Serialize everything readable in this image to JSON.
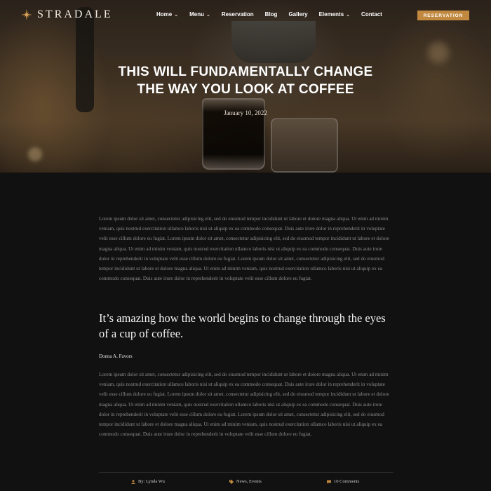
{
  "brand": {
    "name": "STRADALE"
  },
  "nav": {
    "items": [
      {
        "label": "Home",
        "has_dropdown": true
      },
      {
        "label": "Menu",
        "has_dropdown": true
      },
      {
        "label": "Reservation",
        "has_dropdown": false
      },
      {
        "label": "Blog",
        "has_dropdown": false
      },
      {
        "label": "Gallery",
        "has_dropdown": false
      },
      {
        "label": "Elements",
        "has_dropdown": true
      },
      {
        "label": "Contact",
        "has_dropdown": false
      }
    ],
    "reservation_button": "RESERVATION"
  },
  "hero": {
    "title_line1": "THIS WILL FUNDAMENTALLY CHANGE",
    "title_line2": "THE WAY YOU LOOK AT COFFEE",
    "date": "January 10, 2022"
  },
  "article": {
    "paragraph1": "Lorem ipsum dolor sit amet, consectetur adipisicing elit, sed do eiusmod tempor incididunt ut labore et dolore magna aliqua. Ut enim ad minim veniam, quis nostrud exercitation ullamco laboris nisi ut aliquip ex ea commodo consequat. Duis aute irure dolor in reprehenderit in voluptate velit esse cillum dolore eu fugiat. Lorem ipsum dolor sit amet, consectetur adipisicing elit, sed do eiusmod tempor incididunt ut labore et dolore magna aliqua. Ut enim ad minim veniam, quis nostrud exercitation ullamco laboris nisi ut aliquip ex ea commodo consequat. Duis aute irure dolor in reprehenderit in voluptate velit esse cillum dolore eu fugiat. Lorem ipsum dolor sit amet, consectetur adipisicing elit, sed do eiusmod tempor incididunt ut labore et dolore magna aliqua. Ut enim ad minim veniam, quis nostrud exercitation ullamco laboris nisi ut aliquip ex ea commodo consequat. Duis aute irure dolor in reprehenderit in voluptate velit esse cillum dolore eu fugiat.",
    "quote": "It’s amazing how the world begins to change through the eyes of a cup of coffee.",
    "quote_author": "Donna A. Favors",
    "paragraph2": "Lorem ipsum dolor sit amet, consectetur adipisicing elit, sed do eiusmod tempor incididunt ut labore et dolore magna aliqua. Ut enim ad minim veniam, quis nostrud exercitation ullamco laboris nisi ut aliquip ex ea commodo consequat. Duis aute irure dolor in reprehenderit in voluptate velit esse cillum dolore eu fugiat. Lorem ipsum dolor sit amet, consectetur adipisicing elit, sed do eiusmod tempor incididunt ut labore et dolore magna aliqua. Ut enim ad minim veniam, quis nostrud exercitation ullamco laboris nisi ut aliquip ex ea commodo consequat. Duis aute irure dolor in reprehenderit in voluptate velit esse cillum dolore eu fugiat. Lorem ipsum dolor sit amet, consectetur adipisicing elit, sed do eiusmod tempor incididunt ut labore et dolore magna aliqua. Ut enim ad minim veniam, quis nostrud exercitation ullamco laboris nisi ut aliquip ex ea commodo consequat. Duis aute irure dolor in reprehenderit in voluptate velit esse cillum dolore eu fugiat."
  },
  "meta": {
    "author": "By: Lynda Wu",
    "categories": "News, Events",
    "comments": "10 Comments"
  },
  "icons": {
    "logo": "star-logo-icon",
    "author": "user-icon",
    "categories": "tag-icon",
    "comments": "comment-icon"
  },
  "colors": {
    "accent": "#c0893f",
    "background": "#111111",
    "body_text": "#8c8c8c"
  }
}
